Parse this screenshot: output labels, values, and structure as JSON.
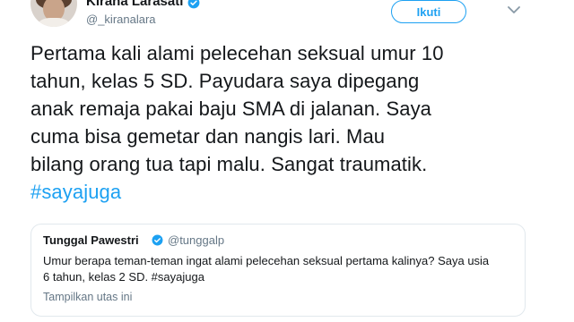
{
  "tweet": {
    "author": {
      "display_name": "Kirana Larasati",
      "handle": "@_kiranalara",
      "verified": true
    },
    "follow_label": "Ikuti",
    "text_lines": [
      "Pertama kali alami pelecehan seksual umur 10",
      "tahun, kelas 5 SD. Payudara saya dipegang",
      "anak remaja pakai baju SMA di jalanan. Saya",
      "cuma bisa gemetar dan nangis lari. Mau",
      "bilang orang tua tapi malu. Sangat traumatik."
    ],
    "hashtag": "#sayajuga"
  },
  "quoted": {
    "display_name": "Tunggal Pawestri",
    "handle": "@tunggalp",
    "verified": true,
    "text_lines": [
      "Umur berapa teman-teman ingat alami pelecehan seksual pertama kalinya? Saya usia",
      "6 tahun, kelas 2 SD. #sayajuga"
    ],
    "thread_link": "Tampilkan utas ini"
  },
  "colors": {
    "accent": "#1da1f2",
    "text": "#14171a",
    "secondary": "#657786",
    "border": "#e1e8ed"
  },
  "icons": [
    "avatar",
    "verified-badge-icon",
    "chevron-down-icon"
  ]
}
